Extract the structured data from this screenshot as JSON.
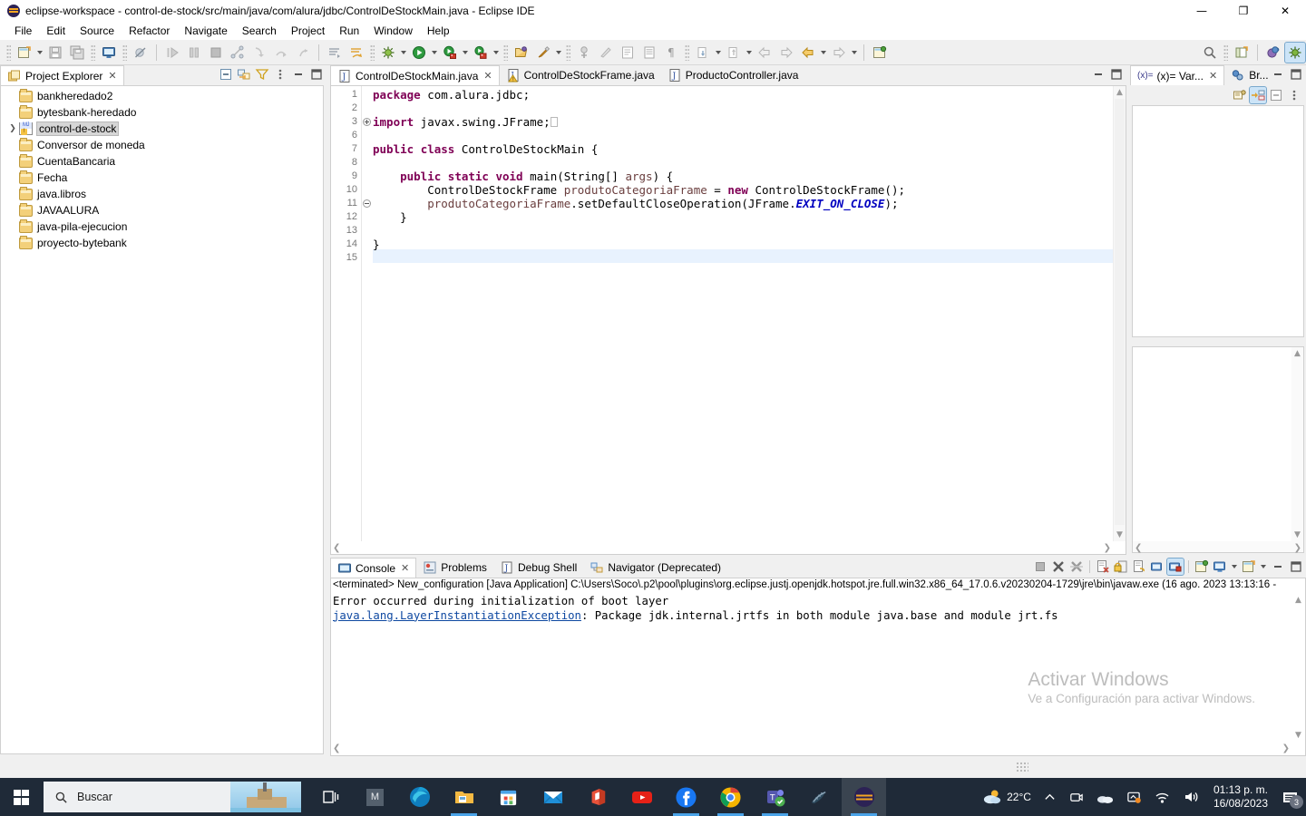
{
  "window": {
    "title": "eclipse-workspace - control-de-stock/src/main/java/com/alura/jdbc/ControlDeStockMain.java - Eclipse IDE",
    "minimize": "—",
    "maximize": "❐",
    "close": "✕"
  },
  "menu": [
    "File",
    "Edit",
    "Source",
    "Refactor",
    "Navigate",
    "Search",
    "Project",
    "Run",
    "Window",
    "Help"
  ],
  "explorer": {
    "tab_label": "Project Explorer",
    "close": "✕",
    "tools": [
      "collapse-all-icon",
      "link-with-editor-icon",
      "view-filter-icon",
      "view-menu-icon",
      "minimize-icon",
      "maximize-icon"
    ],
    "items": [
      {
        "label": "bankheredado2",
        "type": "folder",
        "selected": false,
        "expandable": false
      },
      {
        "label": "bytesbank-heredado",
        "type": "folder",
        "selected": false,
        "expandable": false
      },
      {
        "label": "control-de-stock",
        "type": "java-project",
        "selected": true,
        "expandable": true
      },
      {
        "label": "Conversor de moneda",
        "type": "folder",
        "selected": false,
        "expandable": false
      },
      {
        "label": "CuentaBancaria",
        "type": "folder",
        "selected": false,
        "expandable": false
      },
      {
        "label": "Fecha",
        "type": "folder",
        "selected": false,
        "expandable": false
      },
      {
        "label": "java.libros",
        "type": "folder",
        "selected": false,
        "expandable": false
      },
      {
        "label": "JAVAALURA",
        "type": "folder",
        "selected": false,
        "expandable": false
      },
      {
        "label": "java-pila-ejecucion",
        "type": "folder",
        "selected": false,
        "expandable": false
      },
      {
        "label": "proyecto-bytebank",
        "type": "folder",
        "selected": false,
        "expandable": false
      }
    ]
  },
  "editor": {
    "tabs": [
      {
        "label": "ControlDeStockMain.java",
        "selected": true,
        "warning": false,
        "close": "✕"
      },
      {
        "label": "ControlDeStockFrame.java",
        "selected": false,
        "warning": true
      },
      {
        "label": "ProductoController.java",
        "selected": false,
        "warning": false
      }
    ],
    "line_numbers": [
      "1",
      "2",
      "3",
      "6",
      "7",
      "8",
      "9",
      "10",
      "11",
      "12",
      "13",
      "14",
      "15"
    ],
    "highlighted_line": "15",
    "code_lines": [
      "package com.alura.jdbc;",
      "",
      "import javax.swing.JFrame;",
      "",
      "public class ControlDeStockMain {",
      "",
      "    public static void main(String[] args) {",
      "        ControlDeStockFrame produtoCategoriaFrame = new ControlDeStockFrame();",
      "        produtoCategoriaFrame.setDefaultCloseOperation(JFrame.EXIT_ON_CLOSE);",
      "    }",
      "",
      "}",
      ""
    ]
  },
  "debug_panels": {
    "variables_tab": "(x)= Var...",
    "variables_close": "✕",
    "breakpoints_tab": "Br...",
    "tools": [
      "show-logical-structure-icon",
      "collapse-all-icon",
      "view-menu-icon"
    ]
  },
  "console": {
    "tabs": [
      {
        "label": "Console",
        "selected": true,
        "close": "✕",
        "icon": "console-icon"
      },
      {
        "label": "Problems",
        "selected": false,
        "icon": "problems-icon"
      },
      {
        "label": "Debug Shell",
        "selected": false,
        "icon": "debug-shell-icon"
      },
      {
        "label": "Navigator (Deprecated)",
        "selected": false,
        "icon": "navigator-icon"
      }
    ],
    "header": "<terminated> New_configuration [Java Application] C:\\Users\\Soco\\.p2\\pool\\plugins\\org.eclipse.justj.openjdk.hotspot.jre.full.win32.x86_64_17.0.6.v20230204-1729\\jre\\bin\\javaw.exe  (16 ago. 2023 13:13:16 -",
    "output_line1": "Error occurred during initialization of boot layer",
    "output_link": "java.lang.LayerInstantiationException",
    "output_line2_rest": ": Package jdk.internal.jrtfs in both module java.base and module jrt.fs",
    "tools": [
      "terminate-icon",
      "remove-launch-icon",
      "remove-all-terminated-icon",
      "clear-console-icon",
      "scroll-lock-icon",
      "word-wrap-icon",
      "show-console-icon",
      "pin-console-icon",
      "display-selected-console-icon",
      "open-console-icon",
      "minimize-icon",
      "maximize-icon"
    ]
  },
  "watermark": {
    "line1": "Activar Windows",
    "line2": "Ve a Configuración para activar Windows."
  },
  "taskbar": {
    "search_placeholder": "Buscar",
    "apps": [
      {
        "name": "task-view-icon"
      },
      {
        "name": "m-app-icon",
        "label": "M"
      },
      {
        "name": "microsoft-edge-icon"
      },
      {
        "name": "file-explorer-icon"
      },
      {
        "name": "microsoft-store-icon"
      },
      {
        "name": "mail-icon"
      },
      {
        "name": "office-icon"
      },
      {
        "name": "youtube-icon"
      },
      {
        "name": "facebook-icon"
      },
      {
        "name": "google-chrome-icon"
      },
      {
        "name": "microsoft-teams-icon"
      },
      {
        "name": "mysql-workbench-icon"
      },
      {
        "name": "eclipse-icon"
      }
    ],
    "weather_temp": "22°C",
    "time": "01:13 p. m.",
    "date": "16/08/2023",
    "notification_count": "3"
  },
  "colors": {
    "keyword": "#7f0055",
    "static_field": "#0000c0",
    "local_var": "#6a3e3e",
    "link": "#0e48a1",
    "accent": "#cce4f7",
    "taskbar_bg": "#1f2a38"
  }
}
